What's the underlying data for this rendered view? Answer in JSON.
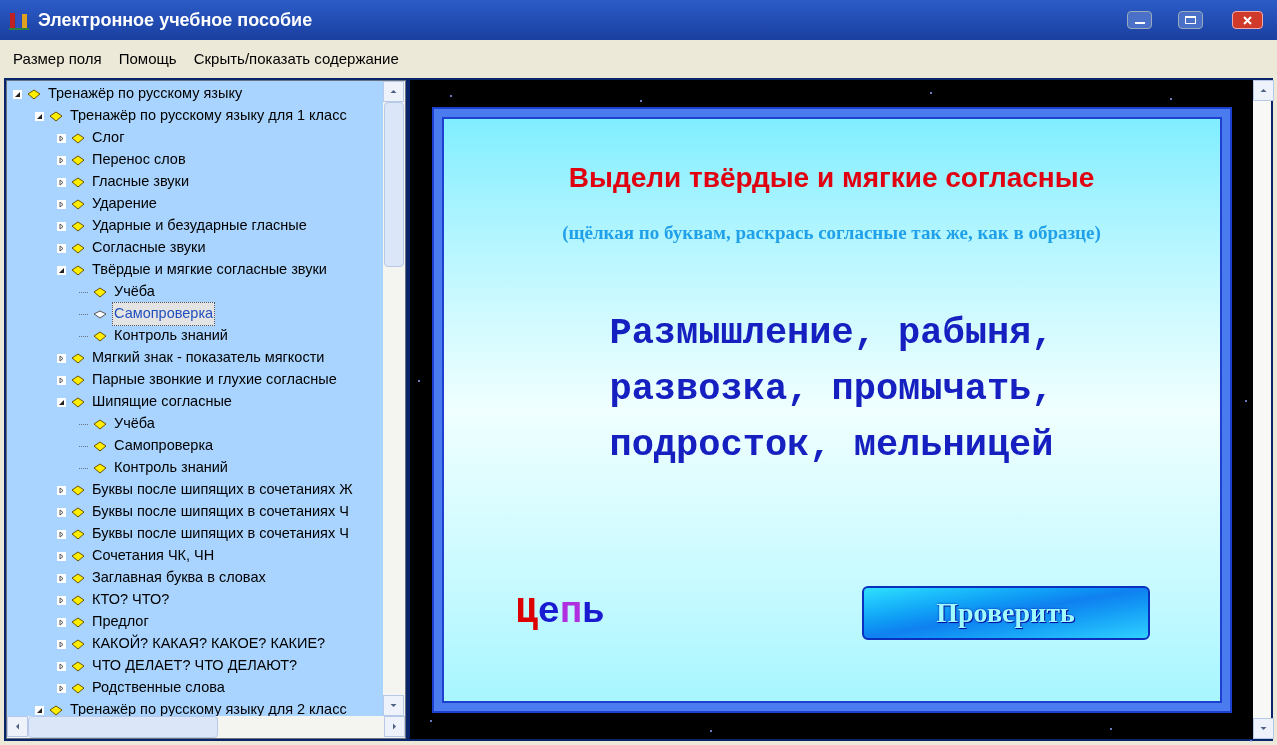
{
  "window": {
    "title": "Электронное учебное пособие"
  },
  "menu": [
    "Размер поля",
    "Помощь",
    "Скрыть/показать содержание"
  ],
  "tree": [
    {
      "kind": "folder",
      "label": "Тренажёр по русскому языку",
      "expanded": true,
      "selected": false,
      "children": [
        {
          "kind": "folder",
          "label": "Тренажёр по русскому языку для 1 класс",
          "expanded": true,
          "selected": false,
          "children": [
            {
              "kind": "folder",
              "label": "Слог",
              "expanded": false,
              "selected": false
            },
            {
              "kind": "folder",
              "label": "Перенос слов",
              "expanded": false,
              "selected": false
            },
            {
              "kind": "folder",
              "label": "Гласные звуки",
              "expanded": false,
              "selected": false
            },
            {
              "kind": "folder",
              "label": "Ударение",
              "expanded": false,
              "selected": false
            },
            {
              "kind": "folder",
              "label": "Ударные и безударные гласные",
              "expanded": false,
              "selected": false
            },
            {
              "kind": "folder",
              "label": "Согласные звуки",
              "expanded": false,
              "selected": false
            },
            {
              "kind": "folder",
              "label": "Твёрдые и мягкие согласные звуки",
              "expanded": true,
              "selected": false,
              "children": [
                {
                  "kind": "leaf",
                  "label": "Учёба",
                  "selected": false
                },
                {
                  "kind": "leaf",
                  "label": "Самопроверка",
                  "selected": true
                },
                {
                  "kind": "leaf",
                  "label": "Контроль знаний",
                  "selected": false
                }
              ]
            },
            {
              "kind": "folder",
              "label": "Мягкий знак - показатель мягкости",
              "expanded": false,
              "selected": false
            },
            {
              "kind": "folder",
              "label": "Парные звонкие и глухие согласные",
              "expanded": false,
              "selected": false
            },
            {
              "kind": "folder",
              "label": "Шипящие согласные",
              "expanded": true,
              "selected": false,
              "children": [
                {
                  "kind": "leaf",
                  "label": "Учёба",
                  "selected": false
                },
                {
                  "kind": "leaf",
                  "label": "Самопроверка",
                  "selected": false
                },
                {
                  "kind": "leaf",
                  "label": "Контроль знаний",
                  "selected": false
                }
              ]
            },
            {
              "kind": "folder",
              "label": "Буквы после шипящих в сочетаниях Ж",
              "expanded": false,
              "selected": false
            },
            {
              "kind": "folder",
              "label": "Буквы после шипящих в сочетаниях Ч",
              "expanded": false,
              "selected": false
            },
            {
              "kind": "folder",
              "label": "Буквы после шипящих в сочетаниях Ч",
              "expanded": false,
              "selected": false
            },
            {
              "kind": "folder",
              "label": "Сочетания ЧК, ЧН",
              "expanded": false,
              "selected": false
            },
            {
              "kind": "folder",
              "label": "Заглавная буква в словах",
              "expanded": false,
              "selected": false
            },
            {
              "kind": "folder",
              "label": "КТО? ЧТО?",
              "expanded": false,
              "selected": false
            },
            {
              "kind": "folder",
              "label": "Предлог",
              "expanded": false,
              "selected": false
            },
            {
              "kind": "folder",
              "label": "КАКОЙ? КАКАЯ? КАКОЕ? КАКИЕ?",
              "expanded": false,
              "selected": false
            },
            {
              "kind": "folder",
              "label": "ЧТО ДЕЛАЕТ? ЧТО ДЕЛАЮТ?",
              "expanded": false,
              "selected": false
            },
            {
              "kind": "folder",
              "label": "Родственные слова",
              "expanded": false,
              "selected": false
            }
          ]
        },
        {
          "kind": "folder",
          "label": "Тренажёр по русскому языку для 2 класс",
          "expanded": true,
          "selected": false
        }
      ]
    }
  ],
  "exercise": {
    "title": "Выдели твёрдые и мягкие согласные",
    "instruction": "(щёлкая по буквам, раскрась согласные так же, как в образце)",
    "lines": [
      "Размышление, рабыня,",
      "развозка, промычать,",
      "подросток, мельницей"
    ],
    "sample": [
      {
        "letter": "Ц",
        "color": "#dd0000"
      },
      {
        "letter": "е",
        "color": "#1a1ad0"
      },
      {
        "letter": "п",
        "color": "#b030e0"
      },
      {
        "letter": "ь",
        "color": "#1a1ad0"
      }
    ],
    "check_button": "Проверить"
  }
}
